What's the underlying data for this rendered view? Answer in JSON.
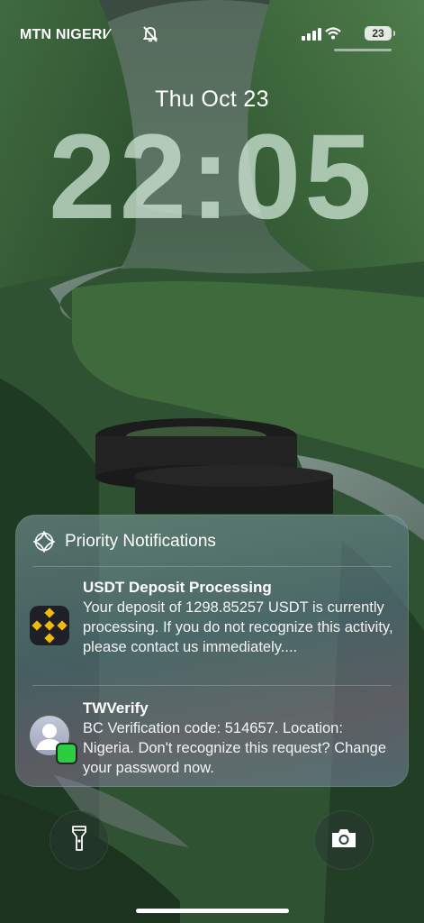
{
  "status_bar": {
    "carrier": "MTN NIGERI∕",
    "battery": "23"
  },
  "lock_screen": {
    "date": "Thu Oct 23",
    "time": "22:05"
  },
  "notifications": {
    "group_title": "Priority Notifications",
    "items": [
      {
        "app": "binance",
        "icon": "binance-icon",
        "title": "USDT Deposit Processing",
        "body": "Your deposit of 1298.85257 USDT is currently processing. If you do not recognize this activity, please contact us immediately...."
      },
      {
        "app": "messages",
        "icon": "contact-avatar-icon",
        "title": "TWVerify",
        "body": "BC Verification code: 514657. Location: Nigeria. Don't recognize this request? Change your password now."
      }
    ]
  },
  "controls": {
    "left": "flashlight-icon",
    "right": "camera-icon"
  },
  "colors": {
    "binance_yellow": "#F0B90B",
    "clock_tint": "#D6EBDC"
  }
}
